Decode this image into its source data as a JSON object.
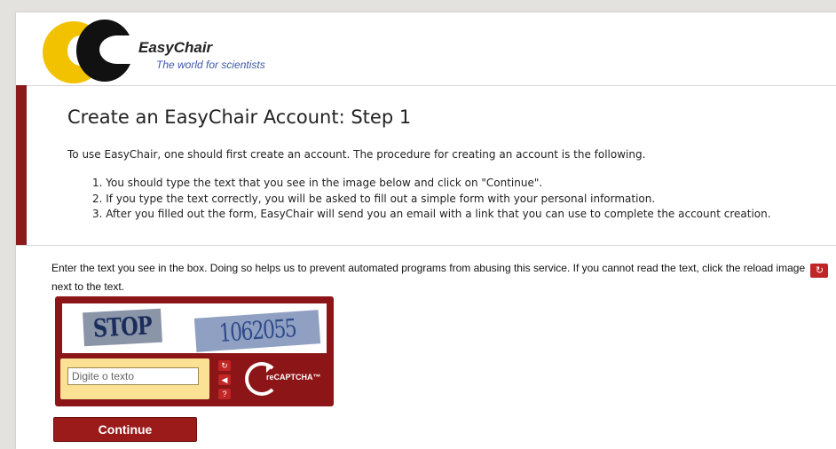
{
  "header": {
    "brand": "EasyChair",
    "tagline": "The world for scientists"
  },
  "intro": {
    "title": "Create an EasyChair Account: Step 1",
    "lead": "To use EasyChair, one should first create an account. The procedure for creating an account is the following.",
    "steps": [
      "1. You should type the text that you see in the image below and click on \"Continue\".",
      "2. If you type the text correctly, you will be asked to fill out a simple form with your personal information.",
      "3. After you filled out the form, EasyChair will send you an email with a link that you can use to complete the account creation."
    ]
  },
  "captcha_section": {
    "instruction_before": "Enter the text you see in the box. Doing so helps us to prevent automated programs from abusing this service. If you cannot read the text, click the reload image",
    "instruction_after": "next to the text.",
    "reload_glyph": "↻",
    "word1": "STOP",
    "word2": "1062055",
    "input_placeholder": "Digite o texto",
    "reload_icon": "↻",
    "audio_icon": "◀",
    "help_icon": "?",
    "recaptcha_label": "reCAPTCHA™"
  },
  "continue_label": "Continue",
  "colors": {
    "accent": "#8b1a1a",
    "captcha_bg": "#8c1517",
    "answer_bg": "#fbe193",
    "tagline": "#3c5aa8"
  }
}
